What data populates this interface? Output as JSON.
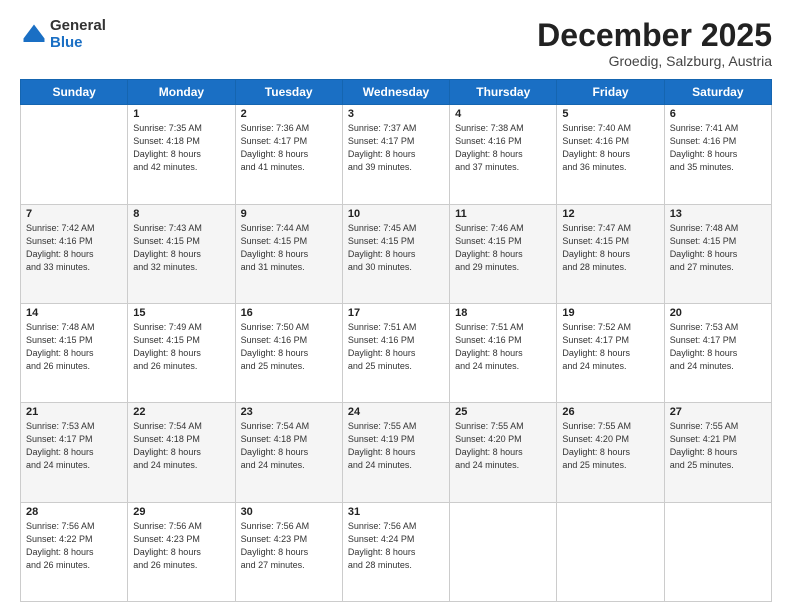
{
  "logo": {
    "general": "General",
    "blue": "Blue"
  },
  "title": "December 2025",
  "subtitle": "Groedig, Salzburg, Austria",
  "weekdays": [
    "Sunday",
    "Monday",
    "Tuesday",
    "Wednesday",
    "Thursday",
    "Friday",
    "Saturday"
  ],
  "weeks": [
    [
      {
        "day": "",
        "info": ""
      },
      {
        "day": "1",
        "info": "Sunrise: 7:35 AM\nSunset: 4:18 PM\nDaylight: 8 hours\nand 42 minutes."
      },
      {
        "day": "2",
        "info": "Sunrise: 7:36 AM\nSunset: 4:17 PM\nDaylight: 8 hours\nand 41 minutes."
      },
      {
        "day": "3",
        "info": "Sunrise: 7:37 AM\nSunset: 4:17 PM\nDaylight: 8 hours\nand 39 minutes."
      },
      {
        "day": "4",
        "info": "Sunrise: 7:38 AM\nSunset: 4:16 PM\nDaylight: 8 hours\nand 37 minutes."
      },
      {
        "day": "5",
        "info": "Sunrise: 7:40 AM\nSunset: 4:16 PM\nDaylight: 8 hours\nand 36 minutes."
      },
      {
        "day": "6",
        "info": "Sunrise: 7:41 AM\nSunset: 4:16 PM\nDaylight: 8 hours\nand 35 minutes."
      }
    ],
    [
      {
        "day": "7",
        "info": "Sunrise: 7:42 AM\nSunset: 4:16 PM\nDaylight: 8 hours\nand 33 minutes."
      },
      {
        "day": "8",
        "info": "Sunrise: 7:43 AM\nSunset: 4:15 PM\nDaylight: 8 hours\nand 32 minutes."
      },
      {
        "day": "9",
        "info": "Sunrise: 7:44 AM\nSunset: 4:15 PM\nDaylight: 8 hours\nand 31 minutes."
      },
      {
        "day": "10",
        "info": "Sunrise: 7:45 AM\nSunset: 4:15 PM\nDaylight: 8 hours\nand 30 minutes."
      },
      {
        "day": "11",
        "info": "Sunrise: 7:46 AM\nSunset: 4:15 PM\nDaylight: 8 hours\nand 29 minutes."
      },
      {
        "day": "12",
        "info": "Sunrise: 7:47 AM\nSunset: 4:15 PM\nDaylight: 8 hours\nand 28 minutes."
      },
      {
        "day": "13",
        "info": "Sunrise: 7:48 AM\nSunset: 4:15 PM\nDaylight: 8 hours\nand 27 minutes."
      }
    ],
    [
      {
        "day": "14",
        "info": "Sunrise: 7:48 AM\nSunset: 4:15 PM\nDaylight: 8 hours\nand 26 minutes."
      },
      {
        "day": "15",
        "info": "Sunrise: 7:49 AM\nSunset: 4:15 PM\nDaylight: 8 hours\nand 26 minutes."
      },
      {
        "day": "16",
        "info": "Sunrise: 7:50 AM\nSunset: 4:16 PM\nDaylight: 8 hours\nand 25 minutes."
      },
      {
        "day": "17",
        "info": "Sunrise: 7:51 AM\nSunset: 4:16 PM\nDaylight: 8 hours\nand 25 minutes."
      },
      {
        "day": "18",
        "info": "Sunrise: 7:51 AM\nSunset: 4:16 PM\nDaylight: 8 hours\nand 24 minutes."
      },
      {
        "day": "19",
        "info": "Sunrise: 7:52 AM\nSunset: 4:17 PM\nDaylight: 8 hours\nand 24 minutes."
      },
      {
        "day": "20",
        "info": "Sunrise: 7:53 AM\nSunset: 4:17 PM\nDaylight: 8 hours\nand 24 minutes."
      }
    ],
    [
      {
        "day": "21",
        "info": "Sunrise: 7:53 AM\nSunset: 4:17 PM\nDaylight: 8 hours\nand 24 minutes."
      },
      {
        "day": "22",
        "info": "Sunrise: 7:54 AM\nSunset: 4:18 PM\nDaylight: 8 hours\nand 24 minutes."
      },
      {
        "day": "23",
        "info": "Sunrise: 7:54 AM\nSunset: 4:18 PM\nDaylight: 8 hours\nand 24 minutes."
      },
      {
        "day": "24",
        "info": "Sunrise: 7:55 AM\nSunset: 4:19 PM\nDaylight: 8 hours\nand 24 minutes."
      },
      {
        "day": "25",
        "info": "Sunrise: 7:55 AM\nSunset: 4:20 PM\nDaylight: 8 hours\nand 24 minutes."
      },
      {
        "day": "26",
        "info": "Sunrise: 7:55 AM\nSunset: 4:20 PM\nDaylight: 8 hours\nand 25 minutes."
      },
      {
        "day": "27",
        "info": "Sunrise: 7:55 AM\nSunset: 4:21 PM\nDaylight: 8 hours\nand 25 minutes."
      }
    ],
    [
      {
        "day": "28",
        "info": "Sunrise: 7:56 AM\nSunset: 4:22 PM\nDaylight: 8 hours\nand 26 minutes."
      },
      {
        "day": "29",
        "info": "Sunrise: 7:56 AM\nSunset: 4:23 PM\nDaylight: 8 hours\nand 26 minutes."
      },
      {
        "day": "30",
        "info": "Sunrise: 7:56 AM\nSunset: 4:23 PM\nDaylight: 8 hours\nand 27 minutes."
      },
      {
        "day": "31",
        "info": "Sunrise: 7:56 AM\nSunset: 4:24 PM\nDaylight: 8 hours\nand 28 minutes."
      },
      {
        "day": "",
        "info": ""
      },
      {
        "day": "",
        "info": ""
      },
      {
        "day": "",
        "info": ""
      }
    ]
  ]
}
